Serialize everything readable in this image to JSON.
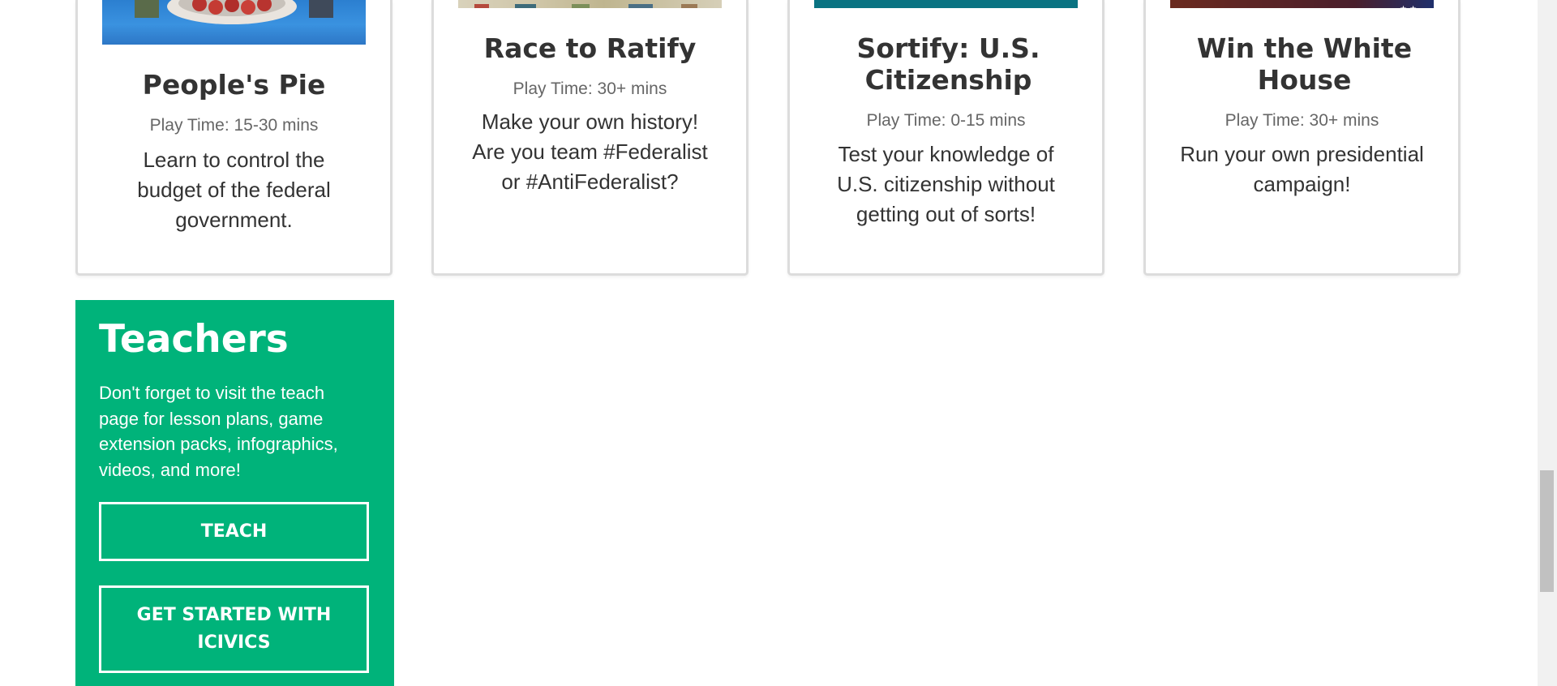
{
  "games": [
    {
      "title": "People's Pie",
      "play_time": "Play Time: 15-30 mins",
      "description": "Learn to control the budget of the federal government.",
      "image_icon": "peoples-pie-thumbnail"
    },
    {
      "title": "Race to Ratify",
      "play_time": "Play Time: 30+ mins",
      "description": "Make your own history! Are you team #Federalist or #AntiFederalist?",
      "image_icon": "race-to-ratify-thumbnail"
    },
    {
      "title": "Sortify: U.S. Citizenship",
      "play_time": "Play Time: 0-15 mins",
      "description": "Test your knowledge of U.S. citizenship without getting out of sorts!",
      "image_icon": "sortify-thumbnail"
    },
    {
      "title": "Win the White House",
      "play_time": "Play Time: 30+ mins",
      "description": "Run your own presidential campaign!",
      "image_icon": "win-the-white-house-thumbnail"
    }
  ],
  "teachers": {
    "title": "Teachers",
    "text": "Don't forget to visit the teach page for lesson plans, game extension packs, infographics, videos, and more!",
    "teach_button": "TEACH",
    "get_started_button": "GET STARTED WITH ICIVICS"
  },
  "colors": {
    "teachers_bg": "#00b37a",
    "card_border": "#dcdcdc",
    "text": "#333333",
    "muted_text": "#666666"
  }
}
